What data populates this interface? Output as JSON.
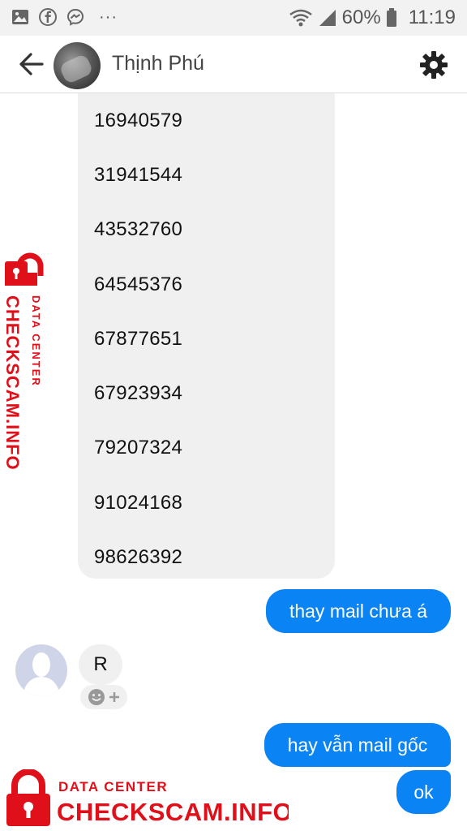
{
  "status_bar": {
    "battery": "60%",
    "time": "11:19",
    "more": "···",
    "icons": [
      "gallery-icon",
      "facebook-icon",
      "messenger-icon",
      "wifi-icon",
      "signal-icon",
      "battery-icon"
    ]
  },
  "header": {
    "contact_name": "Thịnh Phú"
  },
  "messages": {
    "numbers": [
      "16940579",
      "31941544",
      "43532760",
      "64545376",
      "67877651",
      "67923934",
      "79207324",
      "91024168",
      "98626392"
    ],
    "sent_1": "thay mail chưa á",
    "received_1": "R",
    "sent_2": "hay vẫn mail gốc",
    "sent_3": "ok"
  },
  "watermark": {
    "small": "DATA CENTER",
    "large": "CHECKSCAM.INFO"
  },
  "colors": {
    "accent": "#0a84f4",
    "bubble_gray": "#f0f0f0",
    "watermark": "#e0101a"
  }
}
